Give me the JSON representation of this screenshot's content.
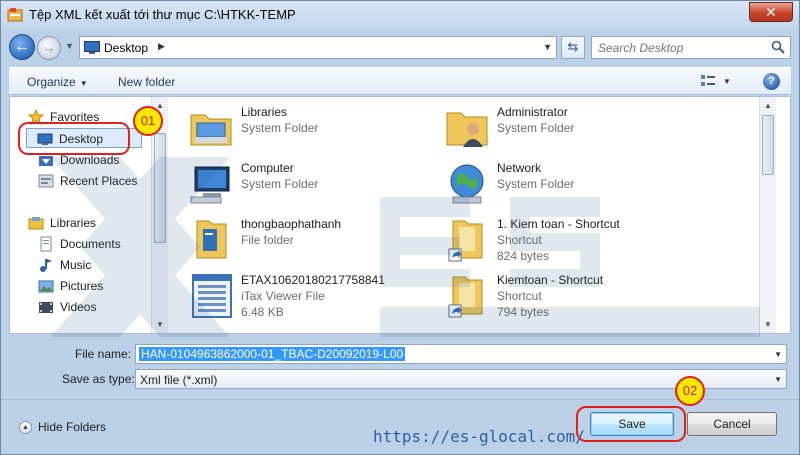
{
  "window": {
    "title": "Tệp XML kết xuất tới thư mục C:\\HTKK-TEMP",
    "close_label": "✕"
  },
  "address": {
    "location": "Desktop",
    "search_placeholder": "Search Desktop"
  },
  "toolbar": {
    "organize": "Organize",
    "new_folder": "New folder"
  },
  "nav": {
    "items": [
      {
        "label": "Favorites",
        "icon": "star-icon"
      },
      {
        "label": "Desktop",
        "icon": "desktop-icon"
      },
      {
        "label": "Downloads",
        "icon": "downloads-icon"
      },
      {
        "label": "Recent Places",
        "icon": "recent-places-icon"
      },
      {
        "label": "Libraries",
        "icon": "libraries-icon"
      },
      {
        "label": "Documents",
        "icon": "documents-icon"
      },
      {
        "label": "Music",
        "icon": "music-icon"
      },
      {
        "label": "Pictures",
        "icon": "pictures-icon"
      },
      {
        "label": "Videos",
        "icon": "videos-icon"
      }
    ]
  },
  "files": [
    {
      "name": "Libraries",
      "type": "System Folder",
      "size": "",
      "icon": "libraries-folder-icon"
    },
    {
      "name": "Administrator",
      "type": "System Folder",
      "size": "",
      "icon": "user-folder-icon"
    },
    {
      "name": "Computer",
      "type": "System Folder",
      "size": "",
      "icon": "computer-icon"
    },
    {
      "name": "Network",
      "type": "System Folder",
      "size": "",
      "icon": "network-icon"
    },
    {
      "name": "thongbaophathanh",
      "type": "File folder",
      "size": "",
      "icon": "folder-icon"
    },
    {
      "name": "1. Kiem toan - Shortcut",
      "type": "Shortcut",
      "size": "824 bytes",
      "icon": "folder-shortcut-icon"
    },
    {
      "name": "ETAX10620180217758841",
      "type": "iTax Viewer File",
      "size": "6.48 KB",
      "icon": "itax-file-icon"
    },
    {
      "name": "Kiemtoan - Shortcut",
      "type": "Shortcut",
      "size": "794 bytes",
      "icon": "folder-shortcut-icon"
    }
  ],
  "form": {
    "file_name_label": "File name:",
    "file_name_value": "HAN-0104963862000-01_TBAC-D20092019-L00",
    "save_type_label": "Save as type:",
    "save_type_value": "Xml file (*.xml)"
  },
  "footer": {
    "hide_folders": "Hide Folders",
    "save": "Save",
    "cancel": "Cancel"
  },
  "annotations": {
    "badge_1": "01",
    "badge_2": "02",
    "url": "https://es-glocal.com/"
  },
  "colors": {
    "accent_red": "#e0211b",
    "badge_yellow": "#ffe800",
    "selection_blue": "#3399ff"
  }
}
